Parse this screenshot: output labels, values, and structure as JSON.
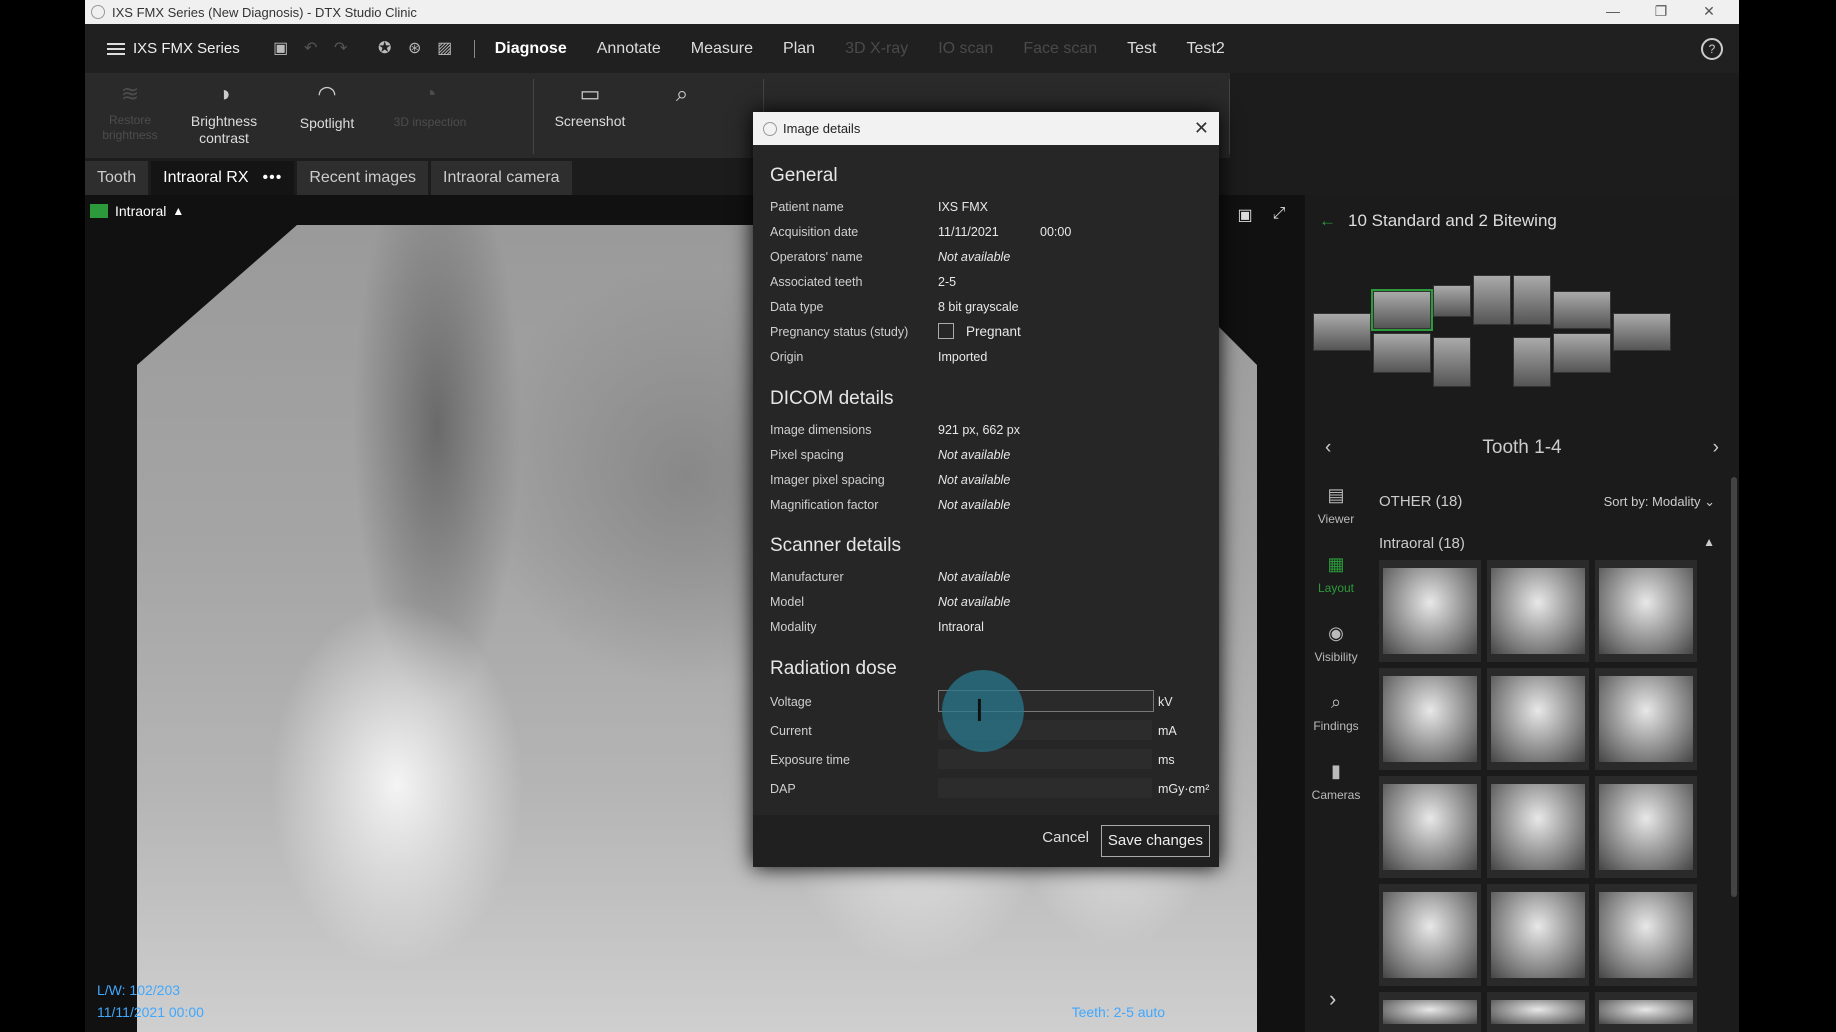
{
  "window": {
    "title": "IXS FMX Series (New Diagnosis) - DTX Studio Clinic"
  },
  "topbar": {
    "menu_label": "IXS FMX Series",
    "tabs": [
      {
        "label": "Diagnose",
        "state": "active"
      },
      {
        "label": "Annotate",
        "state": "normal"
      },
      {
        "label": "Measure",
        "state": "normal"
      },
      {
        "label": "Plan",
        "state": "normal"
      },
      {
        "label": "3D X-ray",
        "state": "disabled"
      },
      {
        "label": "IO scan",
        "state": "disabled"
      },
      {
        "label": "Face scan",
        "state": "disabled"
      },
      {
        "label": "Test",
        "state": "normal"
      },
      {
        "label": "Test2",
        "state": "normal"
      }
    ]
  },
  "ribbon": {
    "tools": [
      {
        "label": "Restore\nbrightness",
        "icon": "layers-icon",
        "state": "disabled"
      },
      {
        "label": "Brightness\ncontrast",
        "icon": "contrast-icon",
        "state": "normal"
      },
      {
        "label": "Spotlight",
        "icon": "spotlight-icon",
        "state": "normal"
      },
      {
        "label": "3D inspection",
        "icon": "inspection-icon",
        "state": "disabled"
      },
      {
        "label": "Screenshot",
        "icon": "screenshot-icon",
        "state": "normal"
      },
      {
        "label": "",
        "icon": "zoom-icon",
        "state": "normal"
      }
    ]
  },
  "view_tabs": [
    "Tooth",
    "Intraoral RX",
    "Recent images",
    "Intraoral camera"
  ],
  "viewer": {
    "label": "Intraoral",
    "lw": "L/W: 102/203",
    "datetime": "11/11/2021 00:00",
    "teeth": "Teeth: 2-5 auto"
  },
  "right_panel": {
    "template_title": "10 Standard and 2 Bitewing",
    "tooth_title": "Tooth 1-4",
    "other_label": "OTHER (18)",
    "sort_label": "Sort by: Modality",
    "group_label": "Intraoral (18)",
    "side_tools": [
      "Viewer",
      "Layout",
      "Visibility",
      "Findings",
      "Cameras"
    ]
  },
  "dialog": {
    "title": "Image details",
    "general": {
      "heading": "General",
      "patient_name_label": "Patient name",
      "patient_name": "IXS FMX",
      "acq_label": "Acquisition date",
      "acq_date": "11/11/2021",
      "acq_time": "00:00",
      "operator_label": "Operators' name",
      "operator": "Not available",
      "teeth_label": "Associated teeth",
      "teeth": "2-5",
      "datatype_label": "Data type",
      "datatype": "8 bit grayscale",
      "pregnancy_label": "Pregnancy status (study)",
      "pregnant_label": "Pregnant",
      "origin_label": "Origin",
      "origin": "Imported"
    },
    "dicom": {
      "heading": "DICOM details",
      "dims_label": "Image dimensions",
      "dims": "921 px, 662 px",
      "pixel_label": "Pixel spacing",
      "pixel": "Not available",
      "imager_label": "Imager pixel spacing",
      "imager": "Not available",
      "mag_label": "Magnification factor",
      "mag": "Not available"
    },
    "scanner": {
      "heading": "Scanner details",
      "manu_label": "Manufacturer",
      "manu": "Not available",
      "model_label": "Model",
      "model": "Not available",
      "modality_label": "Modality",
      "modality": "Intraoral"
    },
    "radiation": {
      "heading": "Radiation dose",
      "voltage_label": "Voltage",
      "voltage_unit": "kV",
      "current_label": "Current",
      "current_unit": "mA",
      "exposure_label": "Exposure time",
      "exposure_unit": "ms",
      "dap_label": "DAP",
      "dap_unit": "mGy·cm²"
    },
    "cancel_label": "Cancel",
    "save_label": "Save changes"
  }
}
